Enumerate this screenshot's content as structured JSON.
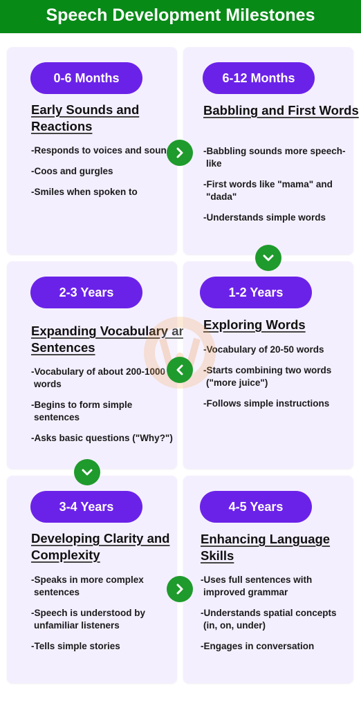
{
  "header": {
    "title": "Speech Development Milestones"
  },
  "colors": {
    "header_bg": "#088a17",
    "card_bg": "#f4effe",
    "pill_bg": "#6b22e8",
    "arrow_bg": "#1f9a2c"
  },
  "stages": [
    {
      "age": "0-6 Months",
      "title": "Early Sounds and Reactions",
      "bullets": [
        "-Responds to voices and sounds",
        "-Coos and gurgles",
        "-Smiles when spoken to"
      ]
    },
    {
      "age": "6-12 Months",
      "title": "Babbling and First Words",
      "bullets": [
        "-Babbling sounds more speech-like",
        "-First words like \"mama\" and \"dada\"",
        "-Understands simple words"
      ]
    },
    {
      "age": "1-2 Years",
      "title": "Exploring Words",
      "bullets": [
        "-Vocabulary of 20-50 words",
        "-Starts combining two words (\"more juice\")",
        "-Follows simple instructions"
      ]
    },
    {
      "age": "2-3 Years",
      "title": "Expanding Vocabulary and Sentences",
      "bullets": [
        "-Vocabulary of about 200-1000 words",
        "-Begins to form simple sentences",
        "-Asks basic questions (\"Why?\")"
      ]
    },
    {
      "age": "3-4 Years",
      "title": "Developing Clarity and Complexity",
      "bullets": [
        "-Speaks in more complex sentences",
        "-Speech is understood by unfamiliar listeners",
        "-Tells simple stories"
      ]
    },
    {
      "age": "4-5 Years",
      "title": "Enhancing Language Skills",
      "bullets": [
        "-Uses full sentences with improved grammar",
        "-Understands spatial concepts (in, on, under)",
        "-Engages in conversation"
      ]
    }
  ],
  "arrows": [
    {
      "from": "0-6 Months",
      "to": "6-12 Months",
      "direction": "right",
      "icon": "chevron-right-icon"
    },
    {
      "from": "6-12 Months",
      "to": "1-2 Years",
      "direction": "down",
      "icon": "chevron-down-icon"
    },
    {
      "from": "1-2 Years",
      "to": "2-3 Years",
      "direction": "left",
      "icon": "chevron-left-icon"
    },
    {
      "from": "2-3 Years",
      "to": "3-4 Years",
      "direction": "down",
      "icon": "chevron-down-icon"
    },
    {
      "from": "3-4 Years",
      "to": "4-5 Years",
      "direction": "right",
      "icon": "chevron-right-icon"
    }
  ]
}
